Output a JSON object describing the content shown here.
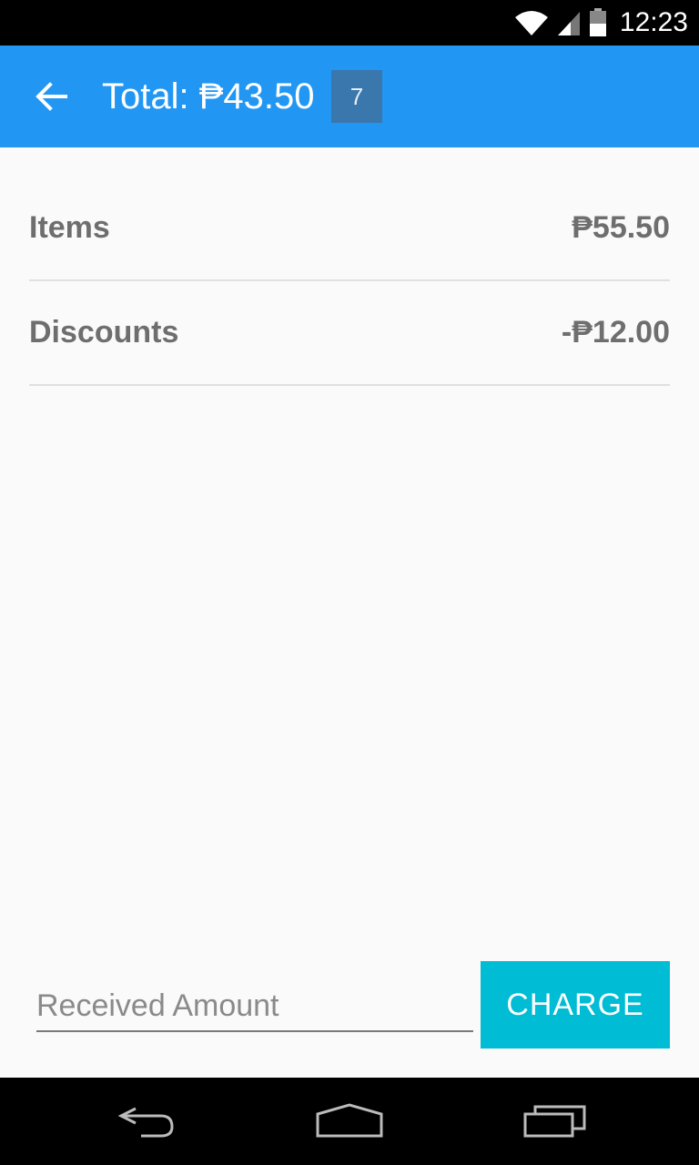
{
  "status_bar": {
    "time": "12:23",
    "icons": [
      "wifi-icon",
      "signal-icon",
      "battery-icon"
    ]
  },
  "app_bar": {
    "title": "Total: ₱43.50",
    "badge": "7",
    "back_icon": "arrow-back-icon",
    "color": "#2196f3"
  },
  "summary": {
    "items": {
      "label": "Items",
      "value": "₱55.50"
    },
    "discounts": {
      "label": "Discounts",
      "value": "-₱12.00"
    }
  },
  "payment": {
    "received_placeholder": "Received Amount",
    "received_value": "",
    "charge_label": "CHARGE",
    "charge_color": "#00bcd4"
  },
  "nav_bar": {
    "icons": [
      "nav-back-icon",
      "nav-home-icon",
      "nav-recents-icon"
    ]
  }
}
